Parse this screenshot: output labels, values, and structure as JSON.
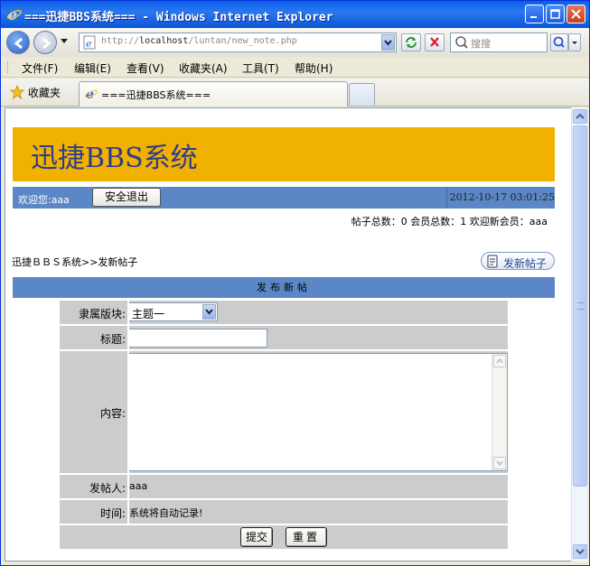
{
  "window": {
    "title": "===迅捷BBS系统=== - Windows Internet Explorer"
  },
  "browser": {
    "address": {
      "prefix": "http://",
      "host": "localhost",
      "path": "/luntan/new_note.php"
    },
    "search_placeholder": "搜搜",
    "menu": [
      "文件(F)",
      "编辑(E)",
      "查看(V)",
      "收藏夹(A)",
      "工具(T)",
      "帮助(H)"
    ],
    "favorites_label": "收藏夹",
    "tab_title": "===迅捷BBS系统==="
  },
  "page": {
    "site_name": "迅捷BBS系统",
    "welcome": "欢迎您:aaa",
    "logout_label": "安全退出",
    "datetime": "2012-10-17 03:01:25",
    "stats": "帖子总数：0 会员总数：1 欢迎新会员：aaa",
    "breadcrumb": "迅捷ＢＢＳ系统>>发新帖子",
    "post_button": "发新帖子",
    "form_title": "发布新帖",
    "form": {
      "board_label": "隶属版块:",
      "board_value": "主题一",
      "title_label": "标题:",
      "title_value": "",
      "content_label": "内容:",
      "poster_label": "发帖人:",
      "poster_value": "aaa",
      "time_label": "时间:",
      "time_value": "系统将自动记录!",
      "submit_label": "提交",
      "reset_label": "重置"
    }
  },
  "colors": {
    "banner": "#f0b100",
    "bar": "#5b87c6",
    "row": "#cccccc",
    "title_text": "#2d3c8e"
  }
}
